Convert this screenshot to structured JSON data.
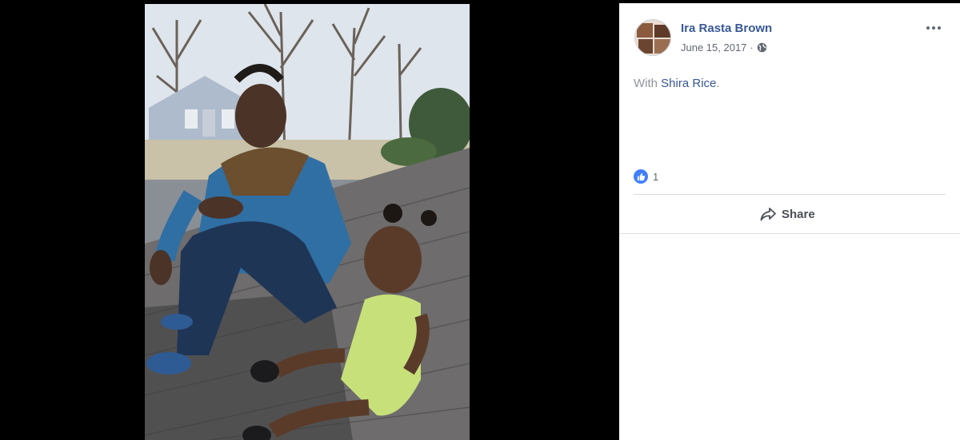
{
  "post": {
    "author": "Ira Rasta Brown",
    "date": "June 15, 2017",
    "separator": "·",
    "privacy_icon": "globe-icon",
    "menu_icon": "more-horizontal-icon",
    "caption_prefix": "With",
    "tagged_person": "Shira Rice",
    "caption_suffix": "."
  },
  "reactions": {
    "icon": "like-icon",
    "count": "1"
  },
  "actions": {
    "share_label": "Share",
    "share_icon": "share-icon"
  },
  "photo": {
    "description_icon": "photo"
  },
  "colors": {
    "link": "#385898",
    "like": "#4080ff",
    "muted": "#616770",
    "viewer_bg": "#000000"
  }
}
